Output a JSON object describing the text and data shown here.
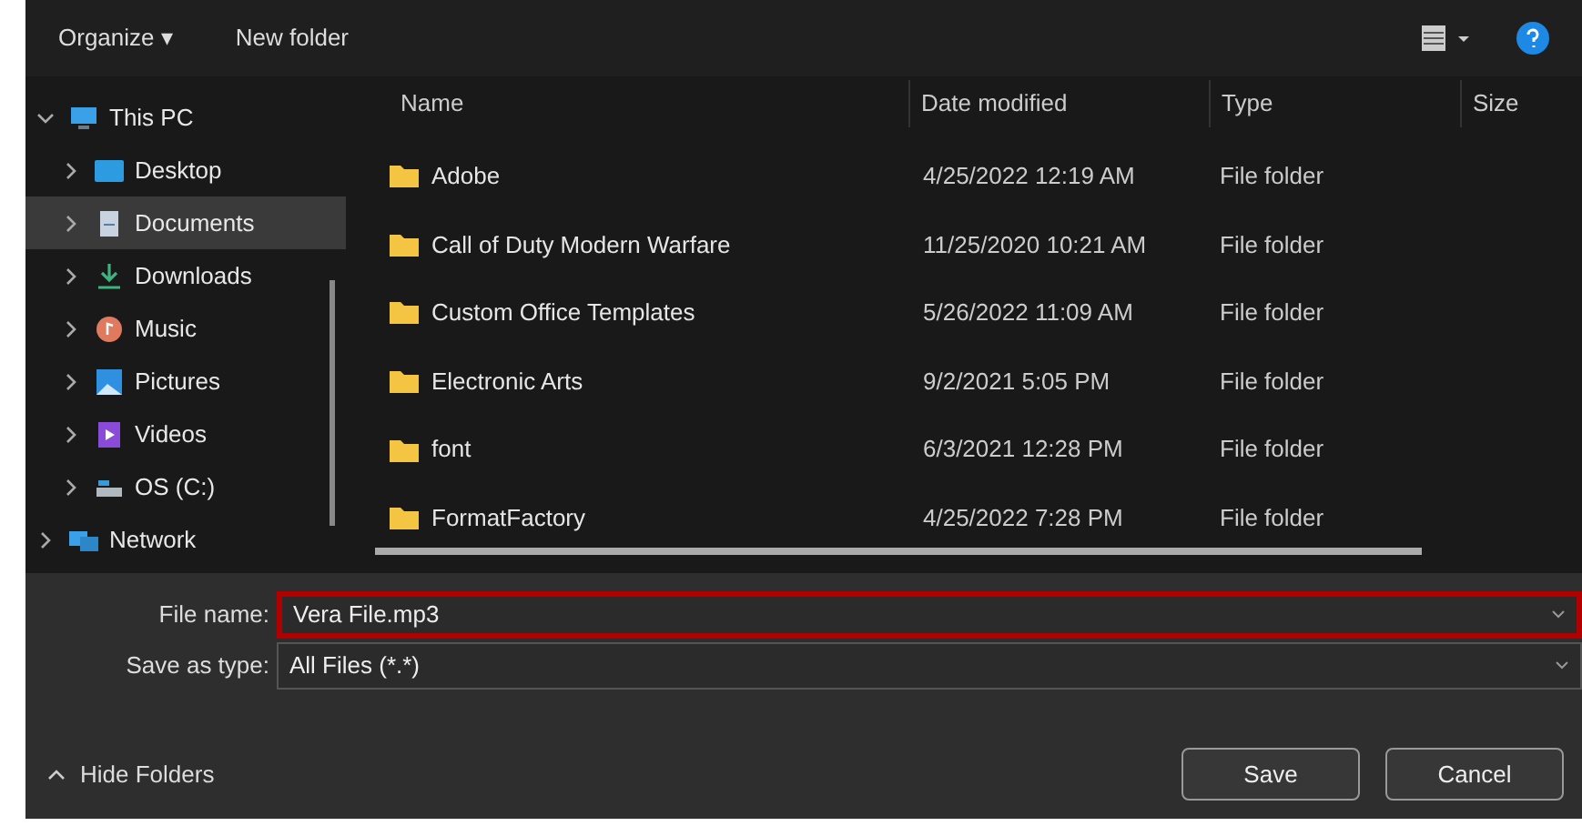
{
  "toolbar": {
    "organize": "Organize ▾",
    "new_folder": "New folder"
  },
  "sidebar": {
    "items": [
      {
        "label": "This PC",
        "kind": "pc",
        "expanded": true,
        "selected": false,
        "children": [
          {
            "label": "Desktop",
            "kind": "desktop",
            "expanded": false,
            "selected": false
          },
          {
            "label": "Documents",
            "kind": "documents",
            "expanded": false,
            "selected": true
          },
          {
            "label": "Downloads",
            "kind": "downloads",
            "expanded": false,
            "selected": false
          },
          {
            "label": "Music",
            "kind": "music",
            "expanded": false,
            "selected": false
          },
          {
            "label": "Pictures",
            "kind": "pictures",
            "expanded": false,
            "selected": false
          },
          {
            "label": "Videos",
            "kind": "videos",
            "expanded": false,
            "selected": false
          },
          {
            "label": "OS (C:)",
            "kind": "drive",
            "expanded": false,
            "selected": false
          }
        ]
      },
      {
        "label": "Network",
        "kind": "network",
        "expanded": false,
        "selected": false
      }
    ]
  },
  "table": {
    "columns": [
      "Name",
      "Date modified",
      "Type",
      "Size"
    ],
    "rows": [
      {
        "name": "Adobe",
        "date": "4/25/2022 12:19 AM",
        "type": "File folder"
      },
      {
        "name": "Call of Duty Modern Warfare",
        "date": "11/25/2020 10:21 AM",
        "type": "File folder"
      },
      {
        "name": "Custom Office Templates",
        "date": "5/26/2022 11:09 AM",
        "type": "File folder"
      },
      {
        "name": "Electronic Arts",
        "date": "9/2/2021 5:05 PM",
        "type": "File folder"
      },
      {
        "name": "font",
        "date": "6/3/2021 12:28 PM",
        "type": "File folder"
      },
      {
        "name": "FormatFactory",
        "date": "4/25/2022 7:28 PM",
        "type": "File folder"
      }
    ]
  },
  "form": {
    "file_name": {
      "label": "File name:",
      "value": "Vera File.mp3",
      "highlighted": true
    },
    "save_as_type": {
      "label": "Save as type:",
      "value": "All Files (*.*)",
      "highlighted": false
    }
  },
  "hide_folders": "Hide Folders",
  "buttons": [
    "Save",
    "Cancel"
  ]
}
